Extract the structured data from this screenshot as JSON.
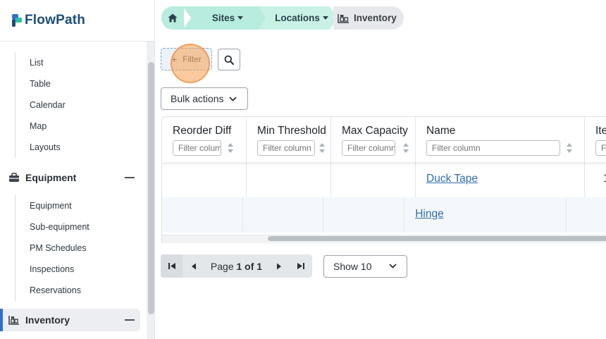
{
  "app": {
    "name": "FlowPath"
  },
  "sidebar": {
    "views": [
      "List",
      "Table",
      "Calendar",
      "Map",
      "Layouts"
    ],
    "equipment": {
      "label": "Equipment",
      "items": [
        "Equipment",
        "Sub-equipment",
        "PM Schedules",
        "Inspections",
        "Reservations"
      ]
    },
    "inventory": {
      "label": "Inventory"
    }
  },
  "breadcrumb": {
    "sites": "Sites",
    "locations": "Locations",
    "current": "Inventory"
  },
  "toolbar": {
    "filter_label": "Filter",
    "filter_plus": "+",
    "bulk_actions_label": "Bulk actions"
  },
  "table": {
    "columns": [
      {
        "label": "Reorder Diff",
        "placeholder": "Filter column"
      },
      {
        "label": "Min Threshold",
        "placeholder": "Filter column"
      },
      {
        "label": "Max Capacity",
        "placeholder": "Filter column"
      },
      {
        "label": "Name",
        "placeholder": "Filter column"
      },
      {
        "label": "Ite",
        "placeholder": "F"
      }
    ],
    "rows": [
      {
        "name": "Duck Tape",
        "item_partial": "1"
      },
      {
        "name": "Hinge",
        "item_partial": ""
      }
    ]
  },
  "pagination": {
    "page_word": "Page",
    "page_current": "1 of 1",
    "show_label": "Show 10"
  },
  "colors": {
    "accent": "#2f6fd0",
    "breadcrumb_mint": "#b7ecde",
    "link": "#2f6db3",
    "click_indicator": "#f7a050"
  }
}
